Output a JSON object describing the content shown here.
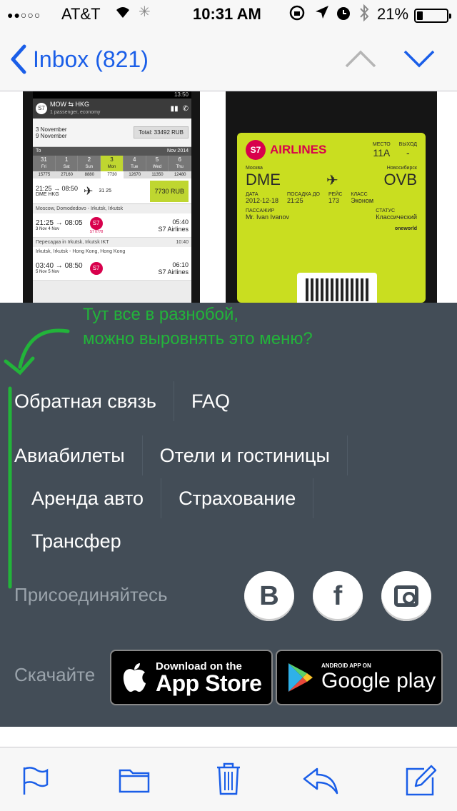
{
  "status_bar": {
    "signal": "●●○○○",
    "carrier": "AT&T",
    "time": "10:31 AM",
    "battery_percent": "21%",
    "battery_level": 0.21
  },
  "nav": {
    "back_label": "Inbox (821)"
  },
  "app_screenshot": {
    "status_time": "13:50",
    "route": "MOW ⇆ HKG",
    "passengers": "1 passenger, economy",
    "date_from": "3 November",
    "date_to": "9 November",
    "total": "Total: 33492 RUB",
    "to_label": "To",
    "month": "Nov 2014",
    "calendar": [
      {
        "d": "31",
        "w": "Fri"
      },
      {
        "d": "1",
        "w": "Sat"
      },
      {
        "d": "2",
        "w": "Sun"
      },
      {
        "d": "3",
        "w": "Mon"
      },
      {
        "d": "4",
        "w": "Tue"
      },
      {
        "d": "5",
        "w": "Wed"
      },
      {
        "d": "6",
        "w": "Thu"
      }
    ],
    "prices": [
      "15775",
      "27160",
      "8880",
      "7730",
      "12670",
      "11350",
      "12480"
    ],
    "flight_times": "21:25 → 08:50",
    "flight_codes": "DME    HKG",
    "flight_days": "31 25",
    "flight_price": "7730 RUB",
    "leg1_route": "Moscow, Domodedovo - Irkutsk, Irkutsk",
    "leg1_times": "21:25 → 08:05",
    "leg1_dates": "3 Nov        4 Nov",
    "leg1_code": "S7 0778",
    "leg1_duration": "05:40",
    "leg1_airline": "S7 Airlines",
    "transfer": "Пересадка in Irkutsk, Irkutsk IKT",
    "transfer_time": "10:40",
    "leg2_route": "Irkutsk, Irkutsk - Hong Kong, Hong Kong",
    "leg2_times": "03:40 → 08:50",
    "leg2_dates": "5 Nov        5 Nov",
    "leg2_duration": "06:10",
    "leg2_airline": "S7 Airlines"
  },
  "boarding_pass": {
    "logo": "S7",
    "airline": "AIRLINES",
    "seat_label": "МЕСТО",
    "seat": "11A",
    "exit_label": "ВЫХОД",
    "exit": "-",
    "from_city": "Москва",
    "to_city": "Новосибирск",
    "from_code": "DME",
    "to_code": "OVB",
    "date_label": "ДАТА",
    "date": "2012-12-18",
    "boarding_label": "ПОСАДКА ДО",
    "boarding": "21:25",
    "flight_label": "РЕЙС",
    "flight": "173",
    "class_label": "КЛАСС",
    "class": "Эконом",
    "passenger_label": "ПАССАЖИР",
    "passenger": "Mr. Ivan Ivanov",
    "status_label": "СТАТУС",
    "status": "Классический",
    "alliance": "oneworld"
  },
  "footer": {
    "annotation_line1": "Тут все в разнобой,",
    "annotation_line2": "можно выровнять это меню?",
    "annotation_color": "#22b43a",
    "menu": {
      "feedback": "Обратная связь",
      "faq": "FAQ",
      "flights": "Авиабилеты",
      "hotels": "Отели и гостиницы",
      "car_rental": "Аренда авто",
      "insurance": "Страхование",
      "transfer": "Трансфер"
    },
    "join_label": "Присоединяйтесь",
    "social": {
      "vk": "В",
      "facebook": "f",
      "instagram": "instagram-icon"
    },
    "download_label": "Скачайте",
    "app_store": {
      "line1": "Download on the",
      "line2": "App Store"
    },
    "google_play": {
      "line1": "ANDROID APP ON",
      "line2": "Google play"
    },
    "background": "#434d57"
  },
  "toolbar": {
    "icons": [
      "flag-icon",
      "folder-icon",
      "trash-icon",
      "reply-icon",
      "compose-icon"
    ],
    "accent": "#1a5ee8"
  }
}
